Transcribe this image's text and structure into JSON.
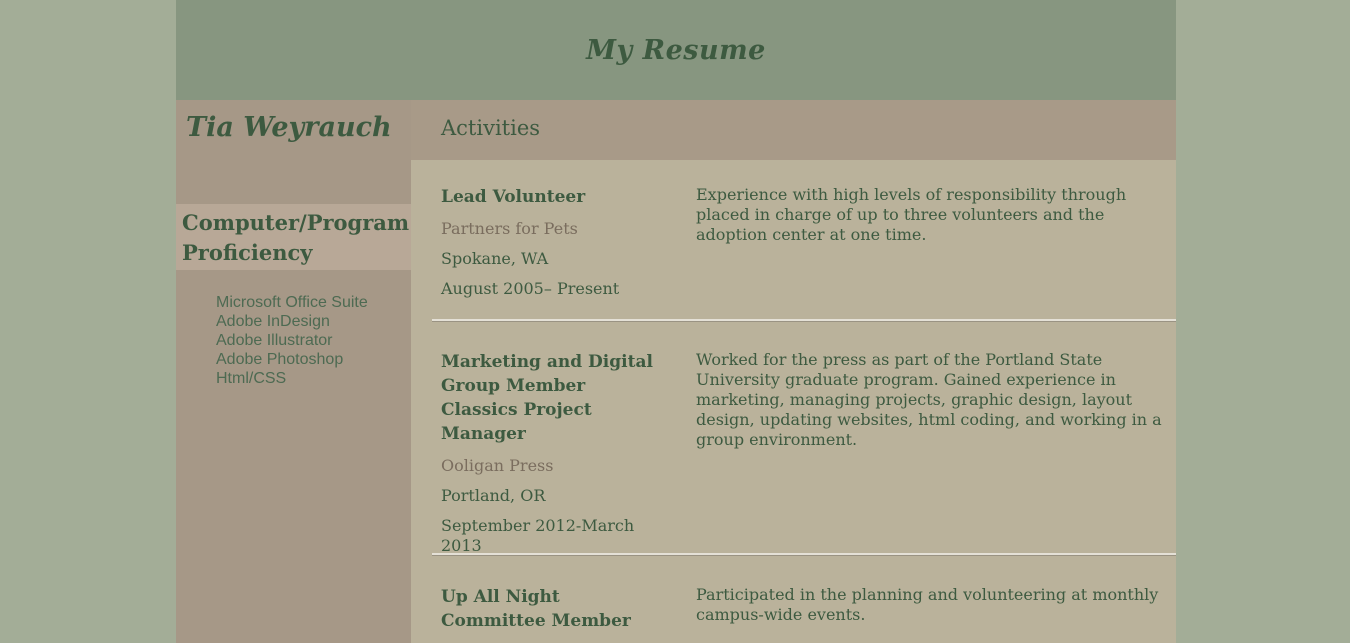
{
  "header": {
    "title": "My Resume"
  },
  "sidebar": {
    "name": "Tia Weyrauch",
    "proficiency_heading": "Computer/Program Proficiency",
    "skills": [
      "Microsoft Office Suite",
      "Adobe InDesign",
      "Adobe Illustrator",
      "Adobe Photoshop",
      "Html/CSS"
    ]
  },
  "main": {
    "section_title": "Activities",
    "entries": [
      {
        "role": "Lead Volunteer",
        "org": "Partners for Pets",
        "location": "Spokane, WA",
        "dates": "August 2005– Present",
        "description": "Experience with high levels of responsibility through placed in charge of up to three volunteers and the adoption center at one time."
      },
      {
        "role_line1": "Marketing and Digital",
        "role_line2": "Group Member",
        "role_line3": "Classics Project Manager",
        "org": "Ooligan Press",
        "location": "Portland, OR",
        "dates": "September 2012-March 2013",
        "description": "Worked for the press as part of the Portland State University graduate program. Gained experience in marketing, managing projects, graphic design, layout design, updating websites, html coding, and working in a group environment."
      },
      {
        "role_line1": "Up All Night",
        "role_line2": "Committee Member",
        "description": "Participated in the planning and volunteering at monthly campus-wide events."
      }
    ]
  },
  "colors": {
    "background": "#a3ad97",
    "header": "#879680",
    "sidebar": "#a69887",
    "content": "#bab29b",
    "text_green": "#3d5a40",
    "org_brown": "#7a6d5e"
  }
}
